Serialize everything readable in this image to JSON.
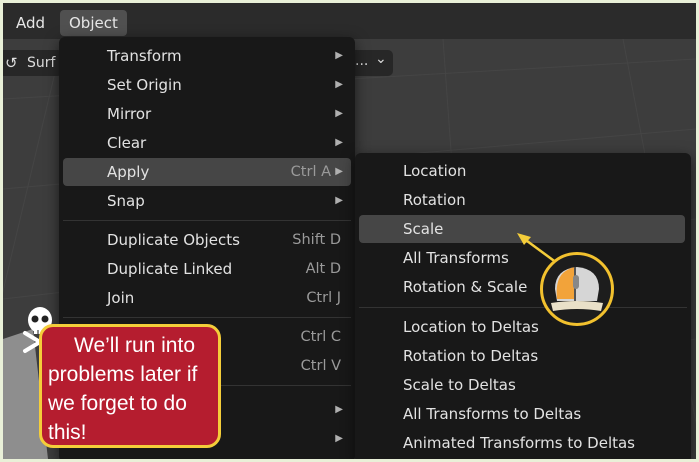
{
  "topbar": {
    "add_label": "Add",
    "object_label": "Object"
  },
  "header": {
    "mode_label": "Surf",
    "dots_label": "...",
    "caret": "⌄"
  },
  "object_menu": [
    {
      "label": "Transform",
      "shortcut": "",
      "submenu": true
    },
    {
      "label": "Set Origin",
      "shortcut": "",
      "submenu": true
    },
    {
      "label": "Mirror",
      "shortcut": "",
      "submenu": true
    },
    {
      "label": "Clear",
      "shortcut": "",
      "submenu": true
    },
    {
      "label": "Apply",
      "shortcut": "Ctrl A",
      "submenu": true,
      "highlighted": true
    },
    {
      "label": "Snap",
      "shortcut": "",
      "submenu": true
    },
    {
      "label": "Duplicate Objects",
      "shortcut": "Shift D",
      "submenu": false
    },
    {
      "label": "Duplicate Linked",
      "shortcut": "Alt D",
      "submenu": false
    },
    {
      "label": "Join",
      "shortcut": "Ctrl J",
      "submenu": false
    },
    {
      "label": "",
      "shortcut": "Ctrl C",
      "submenu": false
    },
    {
      "label": "",
      "shortcut": "Ctrl V",
      "submenu": false
    },
    {
      "label": "",
      "shortcut": "",
      "submenu": true
    },
    {
      "label": "",
      "shortcut": "",
      "submenu": true
    }
  ],
  "apply_menu": [
    {
      "label": "Location"
    },
    {
      "label": "Rotation"
    },
    {
      "label": "Scale",
      "highlighted": true
    },
    {
      "label": "All Transforms"
    },
    {
      "label": "Rotation & Scale"
    },
    {
      "label": "Location to Deltas"
    },
    {
      "label": "Rotation to Deltas"
    },
    {
      "label": "Scale to Deltas"
    },
    {
      "label": "All Transforms to Deltas"
    },
    {
      "label": "Animated Transforms to Deltas"
    }
  ],
  "callout": {
    "text": "We’ll run into problems later if we forget to do this!"
  },
  "icons": {
    "submenu_arrow": "▶",
    "warning": "skull-crossbones-icon",
    "mouse": "mouse-left-click-icon"
  },
  "colors": {
    "menu_bg": "#181818",
    "highlight": "#464646",
    "callout_bg": "#b51d2f",
    "callout_border": "#f4cd3a",
    "mouse_accent": "#f2a33a"
  }
}
